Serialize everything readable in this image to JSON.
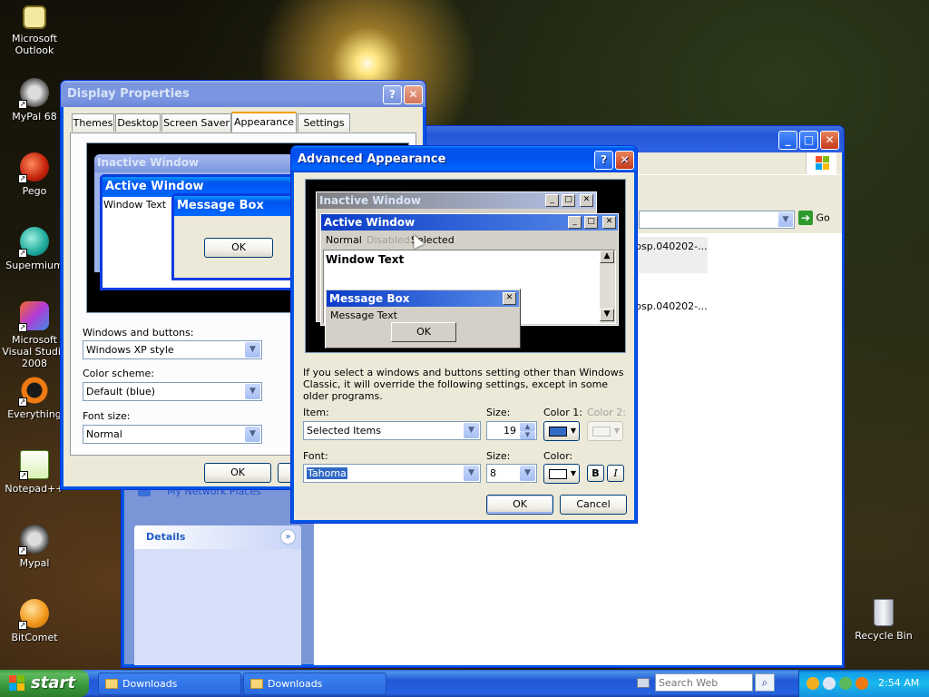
{
  "desktop": {
    "icons": [
      {
        "label": "Microsoft Outlook"
      },
      {
        "label": "MyPal 68"
      },
      {
        "label": "Pego"
      },
      {
        "label": "Supermium"
      },
      {
        "label": "Microsoft Visual Studio 2008"
      },
      {
        "label": "Everything"
      },
      {
        "label": "Notepad++"
      },
      {
        "label": "Mypal"
      },
      {
        "label": "BitComet"
      },
      {
        "label": "Recycle Bin"
      }
    ]
  },
  "explorer": {
    "go_label": "Go",
    "files": [
      "psp.040202-...",
      "psp.040202-..."
    ],
    "sidebar_link": "My Network Places",
    "details_label": "Details"
  },
  "display_properties": {
    "title": "Display Properties",
    "tabs": [
      "Themes",
      "Desktop",
      "Screen Saver",
      "Appearance",
      "Settings"
    ],
    "preview": {
      "inactive_title": "Inactive Window",
      "active_title": "Active Window",
      "window_text": "Window Text",
      "message_box_title": "Message Box",
      "ok_label": "OK"
    },
    "windows_buttons_label": "Windows and buttons:",
    "windows_buttons_value": "Windows XP style",
    "color_scheme_label": "Color scheme:",
    "color_scheme_value": "Default (blue)",
    "font_size_label": "Font size:",
    "font_size_value": "Normal",
    "ok_label": "OK"
  },
  "advanced": {
    "title": "Advanced Appearance",
    "preview": {
      "inactive_title": "Inactive Window",
      "active_title": "Active Window",
      "menu_normal": "Normal",
      "menu_disabled": "Disabled",
      "menu_selected": "Selected",
      "window_text": "Window Text",
      "message_box_title": "Message Box",
      "message_text": "Message Text",
      "ok_label": "OK"
    },
    "info_text": "If you select a windows and buttons setting other than Windows Classic, it will override the following settings, except in some older programs.",
    "item_label": "Item:",
    "item_value": "Selected Items",
    "size_label": "Size:",
    "size_value": "19",
    "color1_label": "Color 1:",
    "color2_label": "Color 2:",
    "font_label": "Font:",
    "font_value": "Tahoma",
    "font_size_label": "Size:",
    "font_size_value": "8",
    "color_label": "Color:",
    "bold_label": "B",
    "italic_label": "I",
    "ok_label": "OK",
    "cancel_label": "Cancel",
    "color1_value": "#316ac5",
    "color_value": "#ffffff"
  },
  "taskbar": {
    "start_label": "start",
    "items": [
      "Downloads",
      "Downloads"
    ],
    "search_placeholder": "Search Web",
    "clock": "2:54 AM"
  }
}
